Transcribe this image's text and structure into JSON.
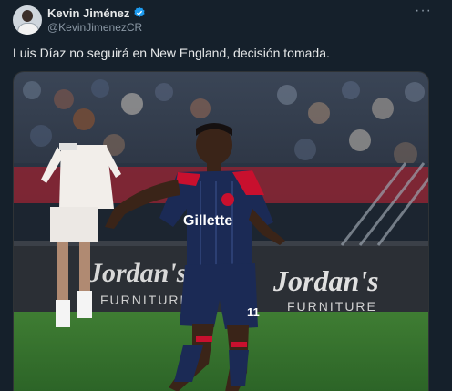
{
  "author": {
    "name": "Kevin Jiménez",
    "handle": "@KevinJimenezCR",
    "verified": true,
    "avatar_icon": "profile-photo-icon"
  },
  "menu": {
    "icon": "more-options-icon",
    "glyph": "···"
  },
  "tweet": {
    "text": "Luis Díaz no seguirá en New England, decisión tomada."
  },
  "media": {
    "jersey_sponsor": "Gillette",
    "board_text_left": "Jordan's",
    "board_sub_left": "FURNITURE",
    "board_text_right": "Jordan's",
    "board_sub_right": "FURNITURE",
    "shorts_number": "11"
  },
  "colors": {
    "background": "#15202b",
    "text": "#e7e9ea",
    "muted": "#8b98a5",
    "verified": "#1d9bf0",
    "pitch": "#2f6f2a",
    "jersey_navy": "#1b2a55",
    "jersey_red": "#c8102e"
  }
}
